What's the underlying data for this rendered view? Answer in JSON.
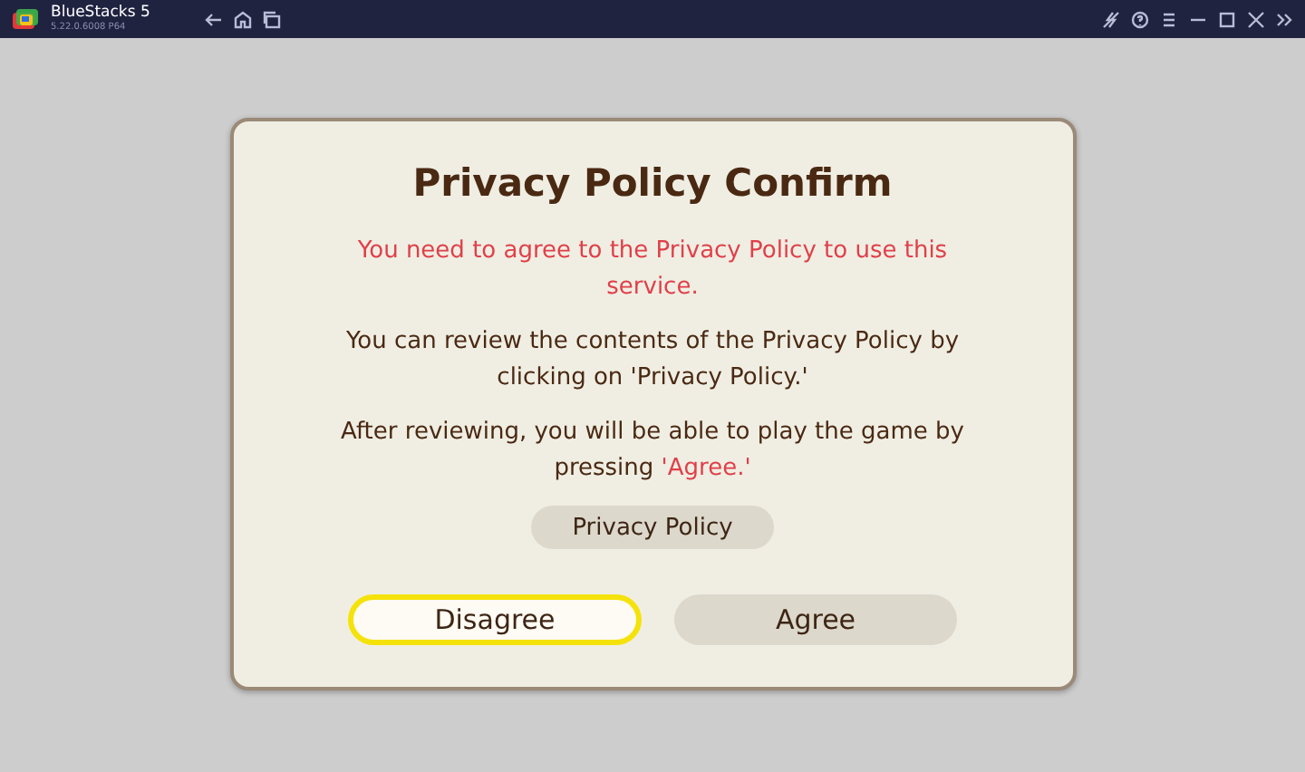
{
  "window": {
    "title": "BlueStacks 5",
    "version": "5.22.0.6008 P64"
  },
  "dialog": {
    "title": "Privacy Policy Confirm",
    "paragraphs": [
      {
        "parts": [
          {
            "text": "You need to agree to the Privacy Policy to use this service.",
            "highlight": true
          }
        ]
      },
      {
        "parts": [
          {
            "text": "You can review the contents of the Privacy Policy by clicking on 'Privacy Policy.'",
            "highlight": false
          }
        ]
      },
      {
        "parts": [
          {
            "text": "After reviewing, you will be able to play the game by pressing ",
            "highlight": false
          },
          {
            "text": "'Agree.'",
            "highlight": true
          }
        ]
      }
    ],
    "link_button": "Privacy Policy",
    "buttons": [
      {
        "label": "Disagree",
        "selected": true
      },
      {
        "label": "Agree",
        "selected": false
      }
    ]
  }
}
